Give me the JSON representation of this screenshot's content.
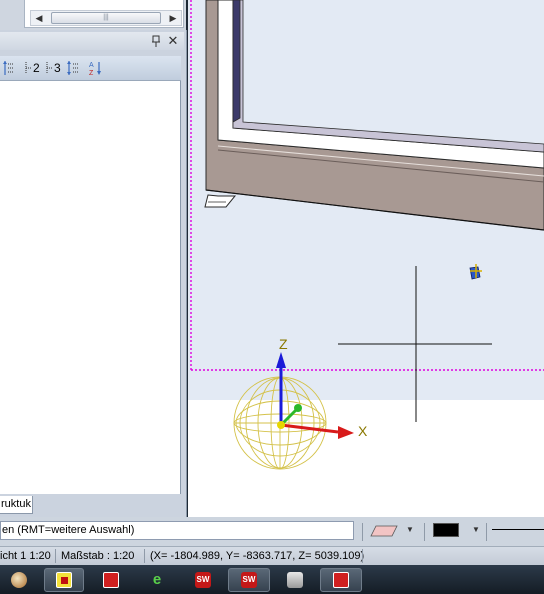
{
  "panel": {
    "toolbar": {
      "level2_label": "2",
      "level3_label": "3"
    },
    "tab_label": "ruktuk"
  },
  "viewport": {
    "axis_z_label": "Z",
    "axis_x_label": "X"
  },
  "command_line": {
    "prompt_text": "en (RMT=weitere Auswahl)"
  },
  "status": {
    "view_text": "icht 1 1:20",
    "scale_text": "Maßstab : 1:20",
    "coords_text": "(X= -1804.989, Y= -8363.717, Z= 5039.109)"
  },
  "colors": {
    "axis_z": "#1a1ad8",
    "axis_x": "#d81a1a",
    "axis_y": "#2ab82a",
    "sphere": "#d4c24a",
    "boundary": "#e000e0",
    "frame": "#9c8c86"
  },
  "taskbar": {
    "apps": [
      {
        "icon": "globe-icon"
      },
      {
        "icon": "yellow-app-icon"
      },
      {
        "icon": "red-app-icon"
      },
      {
        "icon": "green-e-icon"
      },
      {
        "icon": "solidworks-icon"
      },
      {
        "icon": "solidworks-icon"
      },
      {
        "icon": "printer-icon"
      },
      {
        "icon": "red-app-icon"
      }
    ]
  }
}
